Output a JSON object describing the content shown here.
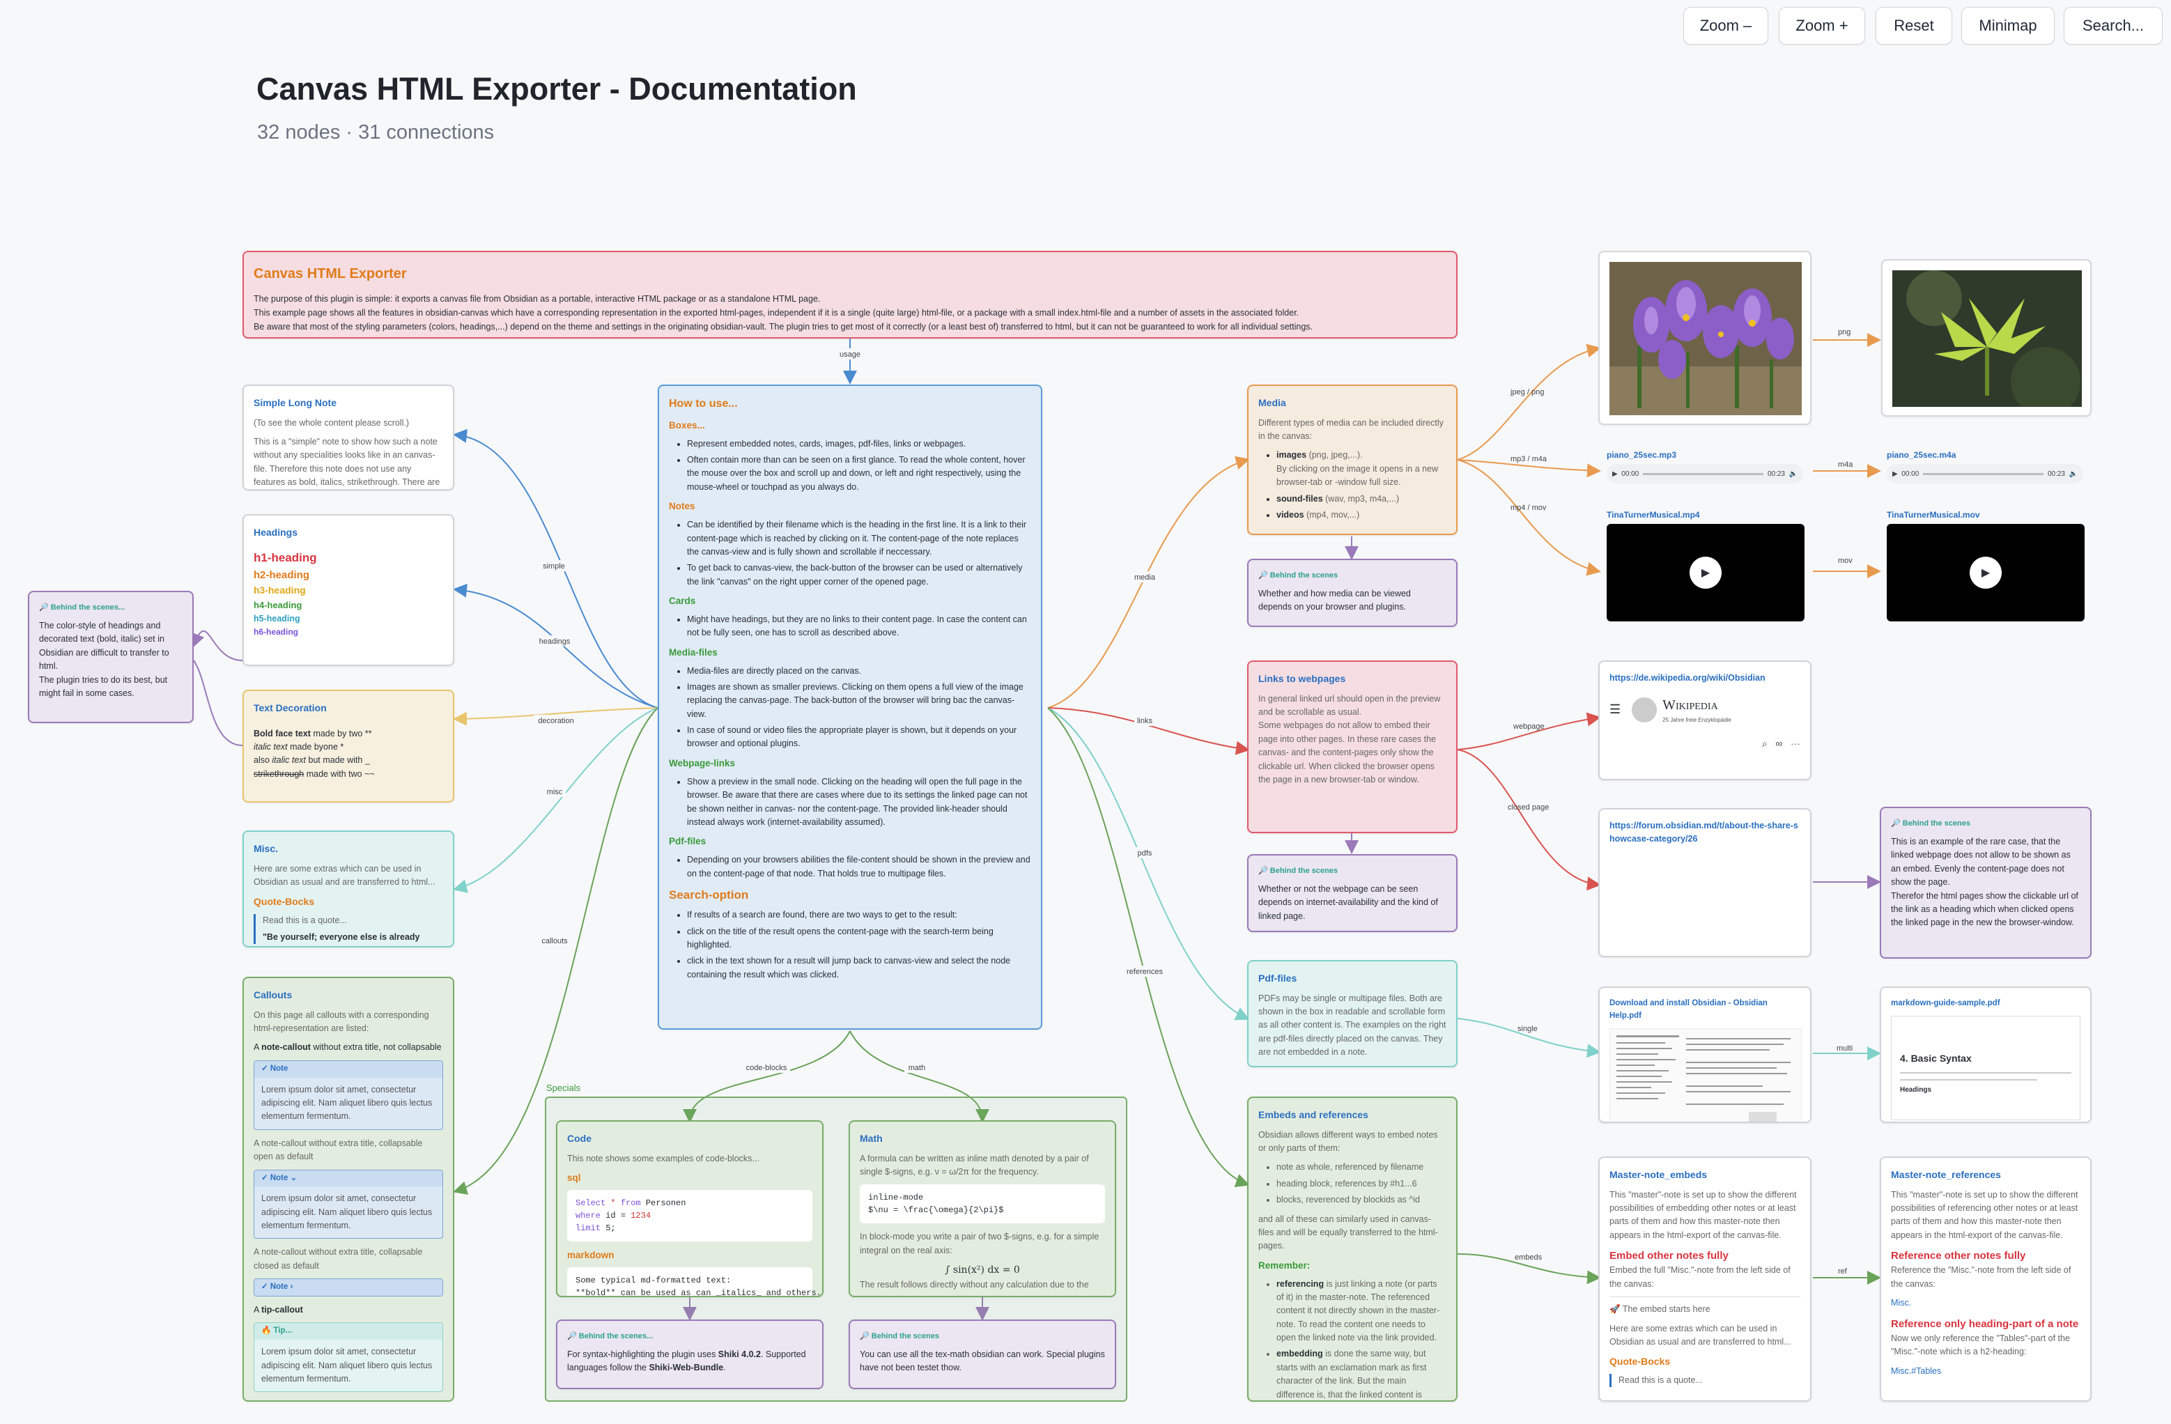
{
  "toolbar": {
    "zoom_out": "Zoom –",
    "zoom_in": "Zoom +",
    "reset": "Reset",
    "minimap": "Minimap",
    "search": "Search..."
  },
  "header": {
    "title": "Canvas HTML Exporter - Documentation",
    "subtitle": "32 nodes · 31 connections"
  },
  "edges": {
    "usage": "usage",
    "simple": "simple",
    "headings": "headings",
    "decoration": "decoration",
    "misc": "misc",
    "callouts": "callouts",
    "media": "media",
    "links": "links",
    "pdfs": "pdfs",
    "references": "references",
    "code_blocks": "code-blocks",
    "math": "math",
    "png": "png",
    "jpeg_png": "jpeg / png",
    "mp3_m4a": "mp3 / m4a",
    "m4a": "m4a",
    "mp4_mov": "mp4 / mov",
    "mov": "mov",
    "webpage": "webpage",
    "closed_page": "closed page",
    "single": "single",
    "multi": "multi",
    "embeds": "embeds",
    "ref": "ref"
  },
  "intro": {
    "title": "Canvas HTML Exporter",
    "p1": "The purpose of this plugin is simple: it exports a canvas file from Obsidian as a portable, interactive HTML package or as a standalone HTML page.",
    "p2": "This example page shows all the features in obsidian-canvas which have a corresponding representation in the exported html-pages, independent if it is a single (quite large) html-file, or a package with a small index.html-file and a number of assets in the associated folder.",
    "p3": "Be aware that most of the styling parameters (colors, headings,...) depend on the theme and settings in the originating obsidian-vault. The plugin tries to get most of it correctly (or a least best of) transferred to html, but it can not be guaranteed to work for all individual settings."
  },
  "howto": {
    "title": "How to use...",
    "boxes_h": "Boxes...",
    "boxes": [
      "Represent embedded notes, cards, images, pdf-files, links or webpages.",
      "Often contain more than can be seen on a first glance. To read the whole content, hover the mouse over the box and scroll up and down, or left and right respectively, using the mouse-wheel or touchpad as you always do."
    ],
    "notes_h": "Notes",
    "notes": [
      "Can be identified by their filename which is the heading in the first line. It is a link to their content-page which is reached by clicking on it. The content-page of the note replaces the canvas-view and is fully shown and scrollable if neccessary.",
      "To get back to canvas-view, the back-button of the browser can be used or alternatively the link \"canvas\" on the right upper corner of the opened page."
    ],
    "cards_h": "Cards",
    "cards": [
      "Might have headings, but they are no links to their content page. In case the content can not be fully seen, one has to scroll as described above."
    ],
    "media_h": "Media-files",
    "media": [
      "Media-files are directly placed on the canvas.",
      "Images are shown as smaller previews. Clicking on them opens a full view of the image replacing the canvas-page. The back-button of the browser will bring bac the canvas-view.",
      "In case of sound or video files the appropriate player is shown, but it depends on your browser and optional plugins."
    ],
    "web_h": "Webpage-links",
    "web": [
      "Show a preview in the small node. Clicking on the heading will open the full page in the browser. Be aware that there are cases where due to its settings the linked page can not be shown neither in canvas- nor the content-page. The provided link-header should instead always work (internet-availability assumed)."
    ],
    "pdf_h": "Pdf-files",
    "pdf": [
      "Depending on your browsers abilities the file-content should be shown in the preview and on the content-page of that node. That holds true to multipage files."
    ],
    "search_h": "Search-option",
    "search": [
      "If results of a search are found, there are two ways to get to the result:",
      "click on the title of the result opens the content-page with the search-term being highlighted.",
      "click in the text shown for a result will jump back to canvas-view and select the node containing the result which was clicked."
    ]
  },
  "simple_note": {
    "title": "Simple Long Note",
    "p1": "(To see the whole content please scroll.)",
    "p2": "This is a \"simple\" note to show how such a note without any specialities looks like in an canvas-file. Therefore this note does not use any features as bold, italics, strikethrough. There are"
  },
  "headings": {
    "title": "Headings",
    "h1": "h1-heading",
    "h2": "h2-heading",
    "h3": "h3-heading",
    "h4": "h4-heading",
    "h5": "h5-heading",
    "h6": "h6-heading"
  },
  "bts_left": {
    "label": "Behind the scenes...",
    "text": "The color-style of headings and decorated text (bold, italic) set in Obsidian are difficult to transfer to html.",
    "text2": "The plugin tries to do its best, but might fail in some cases."
  },
  "decoration": {
    "title": "Text Decoration",
    "bold": "Bold face text",
    "bold_suffix": " made by two **",
    "italic": "italic text",
    "italic_suffix": " made byone *",
    "also": "also ",
    "bi": "italic text",
    "bi_suffix": " but made with _",
    "strike": "strikethrough",
    "strike_suffix": " made with two ~~"
  },
  "misc": {
    "title": "Misc.",
    "text": "Here are some extras which can be used in Obsidian as usual and are transferred to html...",
    "qb": "Quote-Bocks",
    "q1": "Read this is a quote...",
    "q2": "\"Be yourself; everyone else is already"
  },
  "callouts": {
    "title": "Callouts",
    "intro": "On this page all callouts with a corresponding html-representation are listed:",
    "a_pre": "A ",
    "a_b": "note-callout",
    "a_post": " without extra title, not collapsable",
    "note1_h": "✓ Note",
    "lorem": "Lorem ipsum dolor sit amet, consectetur adipiscing elit. Nam aliquet libero quis lectus elementum fermentum.",
    "t2": "A note-callout without extra title, collapsable open as default",
    "note2_h": "✓ Note ⌄",
    "t3": "A note-callout without extra title, collapsable closed as default",
    "note3_h": "✓ Note ›",
    "t4_pre": "A ",
    "t4_b": "tip-callout",
    "tip_h": "🔥 Tip..."
  },
  "specials": {
    "label": "Specials"
  },
  "code": {
    "title": "Code",
    "text": "This note shows some examples of code-blocks...",
    "sql_h": "sql",
    "sql1_a": "Select",
    "sql1_b": " * ",
    "sql1_c": "from",
    "sql1_d": " Personen",
    "sql2_a": "where",
    "sql2_b": " id = ",
    "sql2_c": "1234",
    "sql3_a": "limit",
    "sql3_b": " 5;",
    "md_h": "markdown",
    "md1": "Some typical md-formatted text:",
    "md2": "**bold** can be used as can _italics_ and others."
  },
  "math": {
    "title": "Math",
    "text": "A formula can be written as inline math denoted by a pair of single $-signs, e.g. ν = ω/2π for the frequency.",
    "code1": "inline-mode",
    "code2": "$\\nu = \\frac{\\omega}{2\\pi}$",
    "text2": "In block-mode you write a pair of two $-signs, e.g. for a simple integral on the real axis:",
    "formula": "∫ sin(x²) dx = 0",
    "text3": "The result follows directly without any calculation due to the"
  },
  "bts_code": {
    "label": "Behind the scenes...",
    "text_pre": "For syntax-highlighting the plugin uses ",
    "b1": "Shiki 4.0.2",
    "text_mid": ". Supported languages follow the ",
    "b2": "Shiki-Web-Bundle",
    "text_post": "."
  },
  "bts_math": {
    "label": "Behind the scenes",
    "text": "You can use all the tex-math obsidian can work. Special plugins have not been testet thow."
  },
  "media_node": {
    "title": "Media",
    "text": "Different types of media can be included directly in the canvas:",
    "img_b": "images",
    "img_r": " (png, jpeg,...).",
    "img_d": "By clicking on the image it opens in a new browser-tab or -window full size.",
    "snd_b": "sound-files",
    "snd_r": " (wav, mp3, m4a,...)",
    "vid_b": "videos",
    "vid_r": " (mp4, mov,...)"
  },
  "bts_media": {
    "label": "Behind the scenes",
    "text": "Whether and how media can be viewed depends on your browser and plugins."
  },
  "links_node": {
    "title": "Links to webpages",
    "text": "In general linked url should open in the preview and be scrollable as usual.",
    "text2": "Some webpages do not allow to embed their page into other pages. In these rare cases the canvas- and the content-pages only show the clickable url. When clicked the browser opens the page in a new browser-tab or window."
  },
  "bts_links": {
    "label": "Behind the scenes",
    "text": "Whether or not the webpage can be seen depends on internet-availability and the kind of linked page."
  },
  "pdf_node": {
    "title": "Pdf-files",
    "text": "PDFs may be single or multipage files. Both are shown in the box in readable and scrollable form as all other content is. The examples on the right are pdf-files directly placed on the canvas. They are not embedded in a note."
  },
  "embeds_node": {
    "title": "Embeds and references",
    "text": "Obsidian allows different ways to embed notes or only parts of them:",
    "l1": "note as whole, referenced by filename",
    "l2": "heading block, references by #h1...6",
    "l3": "blocks, reverenced by blockids as ^id",
    "text2": "and all of these can similarly used in canvas-files and will be equally transferred to the html-pages.",
    "rem": "Remember:",
    "r1_b": "referencing",
    "r1": " is just linking a note (or parts of it) in the master-note. The referenced content it not directly shown in the master-note. To read the content one needs to open the linked note via the link provided.",
    "r2_b": "embedding",
    "r2": " is done the same way, but starts with an exclamation mark as first character of the link. But the main difference is, that the linked content is directly visible in the master-note as if it is"
  },
  "media_files": {
    "audio1": "piano_25sec.mp3",
    "audio2": "piano_25sec.m4a",
    "video1": "TinaTurnerMusical.mp4",
    "video2": "TinaTurnerMusical.mov",
    "audio_start": "00:00",
    "audio_end": "00:23"
  },
  "web1": {
    "url": "https://de.wikipedia.org/wiki/Obsidian",
    "wiki": "Wikipedia",
    "wiki_sub": "25 Jahre freie Enzyklopädie"
  },
  "web2": {
    "url": "https://forum.obsidian.md/t/about-the-share-showcase-category/26"
  },
  "bts_web": {
    "label": "Behind the scenes",
    "text": "This is an example of the rare case, that the linked webpage does not allow to be shown as an embed. Evenly the content-page does not show the page.",
    "text2": "Therefor the html pages show the clickable url of the link as a heading which when clicked opens the linked page in the new the browser-window."
  },
  "pdf1": {
    "title": "Download and install Obsidian - Obsidian Help.pdf"
  },
  "pdf2": {
    "title": "markdown-guide-sample.pdf",
    "h": "4. Basic Syntax",
    "sub": "Headings"
  },
  "master_embeds": {
    "title": "Master-note_embeds",
    "text": "This \"master\"-note is set up to show the different possibilities of embedding other notes or at least parts of them and how this master-note then appears in the html-export of the canvas-file.",
    "h": "Embed other notes fully",
    "text2": "Embed the full \"Misc.\"-note from the left side of the canvas:",
    "start": "🚀 The embed starts here",
    "text3": "Here are some extras which can be used in Obsidian as usual and are transferred to html...",
    "qb": "Quote-Bocks",
    "q": "Read this is a quote..."
  },
  "master_refs": {
    "title": "Master-note_references",
    "text": "This \"master\"-note is set up to show the different possibilities of referencing other notes or at least parts of them and how this master-note then appears in the html-export of the canvas-file.",
    "h": "Reference other notes fully",
    "text2": "Reference the \"Misc.\"-note from the left side of the canvas:",
    "link": "Misc.",
    "h2": "Reference only heading-part of a note",
    "text3": "Now we only reference the \"Tables\"-part of the \"Misc.\"-note which is a h2-heading:",
    "link2": "Misc.#Tables"
  }
}
